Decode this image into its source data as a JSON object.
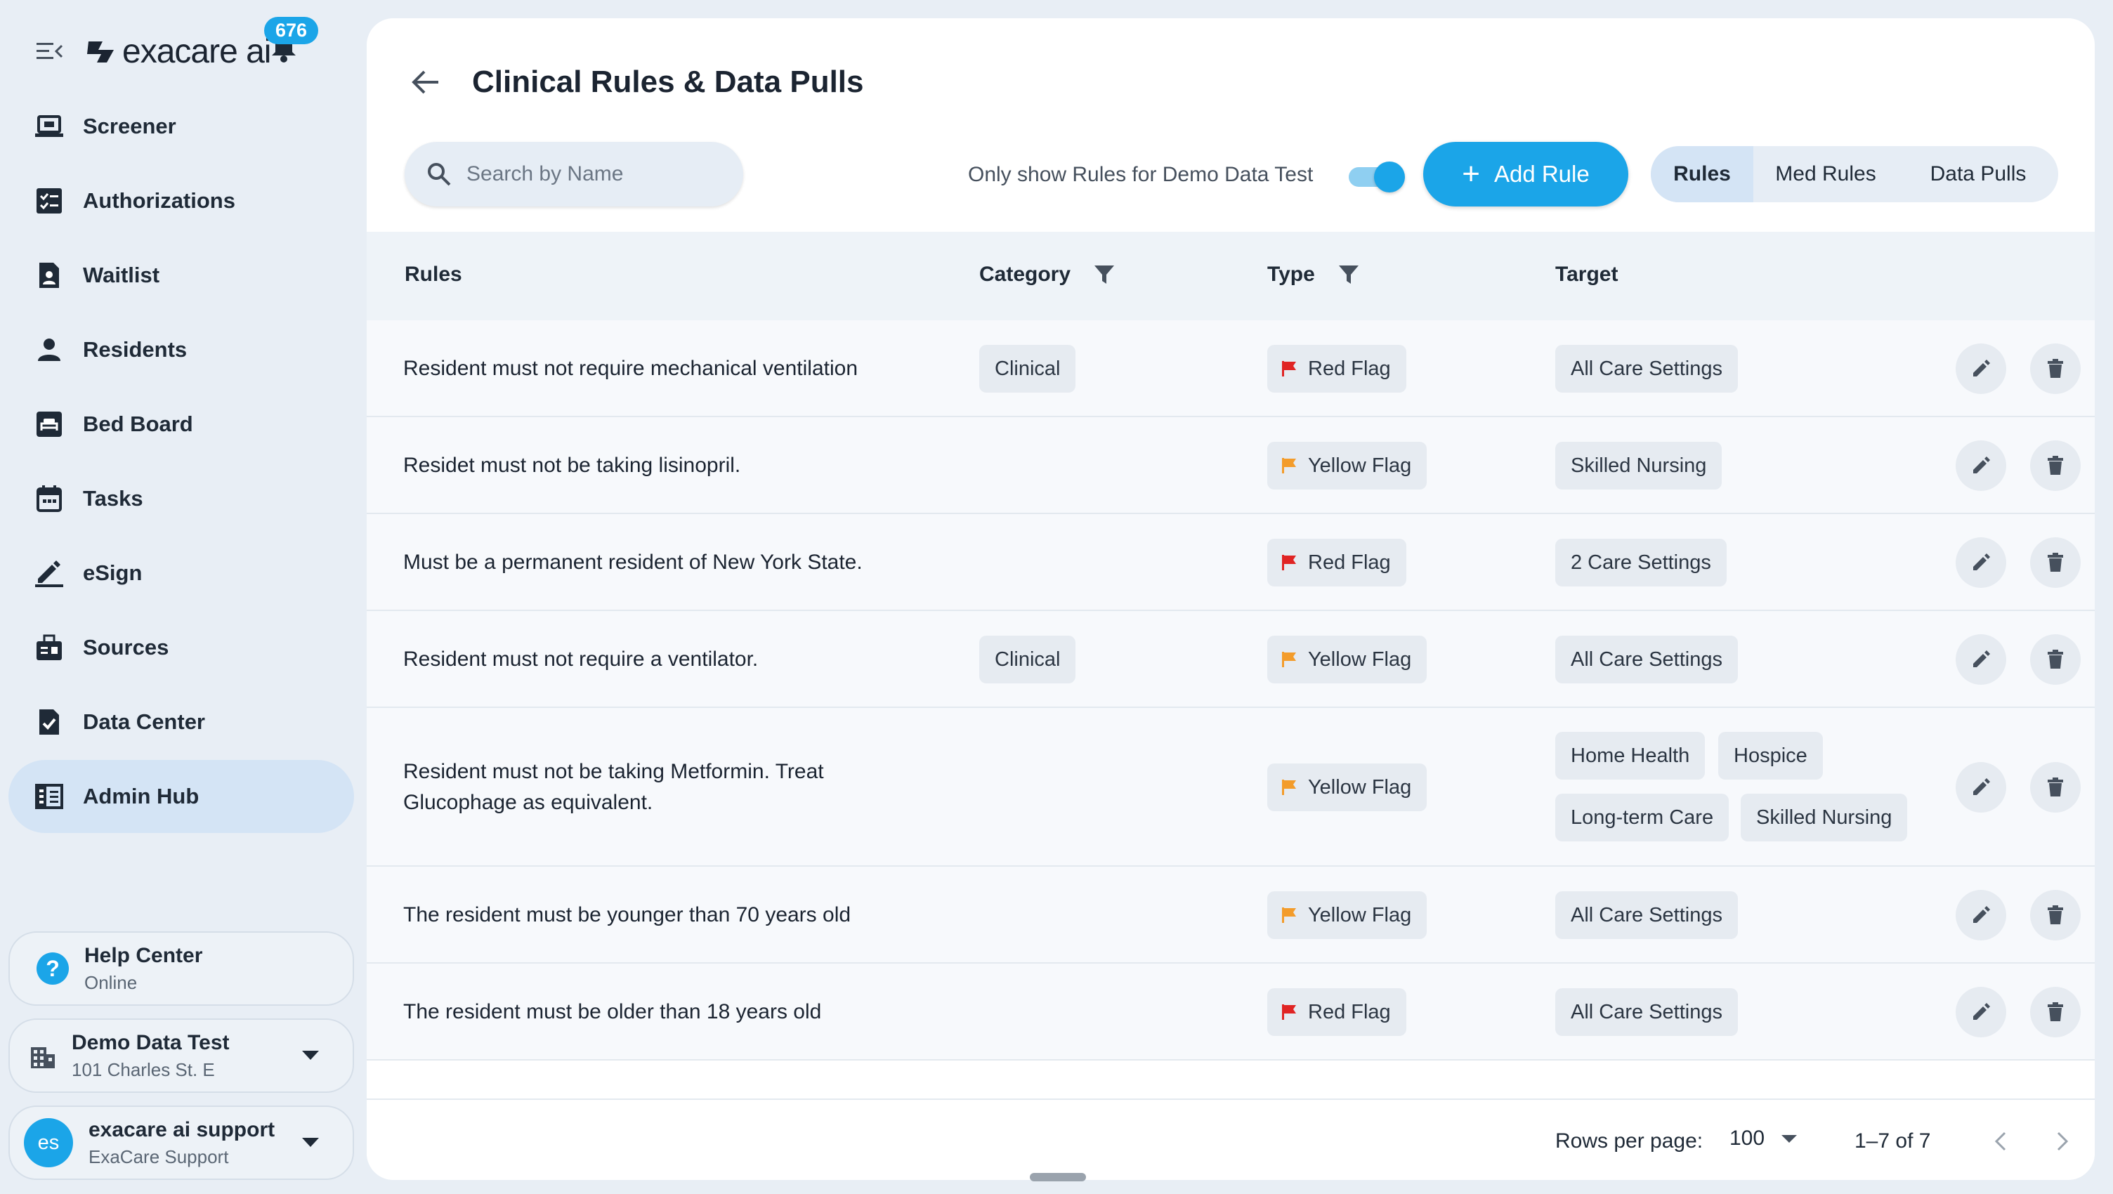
{
  "brand": {
    "name": "exacare ai",
    "notification_count": "676"
  },
  "nav": [
    {
      "id": "screener",
      "label": "Screener",
      "icon": "laptop-icon"
    },
    {
      "id": "authorizations",
      "label": "Authorizations",
      "icon": "checklist-icon"
    },
    {
      "id": "waitlist",
      "label": "Waitlist",
      "icon": "person-doc-icon"
    },
    {
      "id": "residents",
      "label": "Residents",
      "icon": "person-icon"
    },
    {
      "id": "bed-board",
      "label": "Bed Board",
      "icon": "bed-icon"
    },
    {
      "id": "tasks",
      "label": "Tasks",
      "icon": "calendar-icon"
    },
    {
      "id": "esign",
      "label": "eSign",
      "icon": "pen-icon"
    },
    {
      "id": "sources",
      "label": "Sources",
      "icon": "sources-icon"
    },
    {
      "id": "data-center",
      "label": "Data Center",
      "icon": "doc-check-icon"
    },
    {
      "id": "admin-hub",
      "label": "Admin Hub",
      "icon": "building-grid-icon",
      "active": true
    }
  ],
  "help": {
    "title": "Help Center",
    "status": "Online"
  },
  "facility": {
    "name": "Demo Data Test",
    "address": "101 Charles St. E"
  },
  "user": {
    "initials": "es",
    "name": "exacare ai support",
    "org": "ExaCare Support"
  },
  "page": {
    "title": "Clinical Rules & Data Pulls"
  },
  "search": {
    "placeholder": "Search by Name",
    "value": ""
  },
  "filter_toggle": {
    "label": "Only show Rules for Demo Data Test",
    "on": true
  },
  "add_button": {
    "label": "Add Rule"
  },
  "tabs": [
    {
      "label": "Rules",
      "active": true
    },
    {
      "label": "Med Rules",
      "active": false
    },
    {
      "label": "Data Pulls",
      "active": false
    }
  ],
  "table": {
    "headers": {
      "rules": "Rules",
      "category": "Category",
      "type": "Type",
      "target": "Target"
    },
    "rows": [
      {
        "rule": "Resident must not require mechanical ventilation",
        "category": "Clinical",
        "type": "Red Flag",
        "flag": "red",
        "targets": [
          "All Care Settings"
        ]
      },
      {
        "rule": "Residet must not be taking lisinopril.",
        "category": "",
        "type": "Yellow Flag",
        "flag": "yellow",
        "targets": [
          "Skilled Nursing"
        ]
      },
      {
        "rule": "Must be a permanent resident of New York State.",
        "category": "",
        "type": "Red Flag",
        "flag": "red",
        "targets": [
          "2 Care Settings"
        ]
      },
      {
        "rule": "Resident must not require a ventilator.",
        "category": "Clinical",
        "type": "Yellow Flag",
        "flag": "yellow",
        "targets": [
          "All Care Settings"
        ]
      },
      {
        "rule": "Resident must not be taking Metformin. Treat Glucophage as equivalent.",
        "category": "",
        "type": "Yellow Flag",
        "flag": "yellow",
        "targets": [
          "Home Health",
          "Hospice",
          "Long-term Care",
          "Skilled Nursing"
        ]
      },
      {
        "rule": "The resident must be younger than 70 years old",
        "category": "",
        "type": "Yellow Flag",
        "flag": "yellow",
        "targets": [
          "All Care Settings"
        ]
      },
      {
        "rule": "The resident must be older than 18 years old",
        "category": "",
        "type": "Red Flag",
        "flag": "red",
        "targets": [
          "All Care Settings"
        ]
      }
    ]
  },
  "pagination": {
    "rows_label": "Rows per page:",
    "rows_value": "100",
    "range": "1–7 of 7"
  },
  "colors": {
    "accent": "#1ba5e8",
    "red_flag": "#e02424",
    "yellow_flag": "#f39c2b"
  }
}
